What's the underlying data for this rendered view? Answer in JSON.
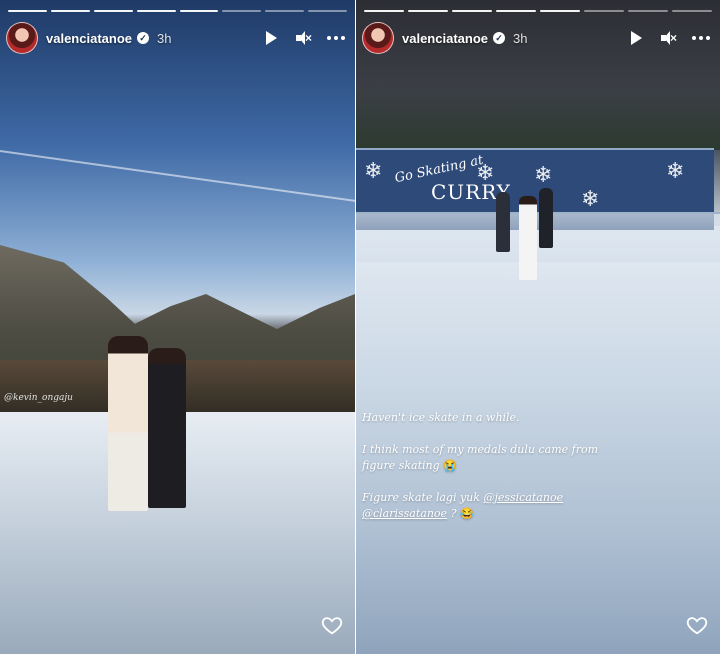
{
  "stories": [
    {
      "username": "valenciatanoe",
      "verified": true,
      "time": "3h",
      "progress": {
        "total": 8,
        "completed": 5
      },
      "photo_credit": "@kevin_ongaju",
      "audio": "muted"
    },
    {
      "username": "valenciatanoe",
      "verified": true,
      "time": "3h",
      "progress": {
        "total": 8,
        "completed": 5
      },
      "audio": "muted",
      "banner": {
        "line1": "Go Skating at",
        "line2": "CURRY"
      },
      "caption": {
        "line1": "Haven't ice skate in a while.",
        "line2a": "I think most of my medals dulu came from",
        "line2b": "figure skating",
        "line2_emoji": "😭",
        "line3a": "Figure skate lagi yuk",
        "mention1": "@jessicatanoe",
        "mention2": "@clarissatanoe",
        "line3_end": "?",
        "line3_emoji": "😂"
      }
    }
  ],
  "icons": {
    "play": "play-icon",
    "mute": "muted-speaker-icon",
    "more": "more-options-icon",
    "like": "heart-icon",
    "verified": "verified-badge-icon"
  },
  "colors": {
    "overlay_text": "#ffffff",
    "banner_blue": "#2e4a78"
  }
}
